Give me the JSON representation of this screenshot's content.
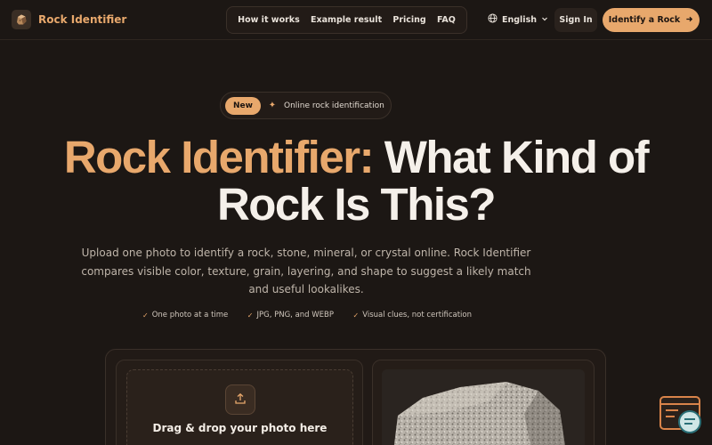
{
  "header": {
    "brand": "Rock Identifier",
    "nav": [
      "How it works",
      "Example result",
      "Pricing",
      "FAQ"
    ],
    "language": "English",
    "sign_in": "Sign In",
    "cta": "Identify a Rock"
  },
  "badge": {
    "label": "New",
    "text": "Online rock identification"
  },
  "hero": {
    "title_accent": "Rock Identifier:",
    "title_rest": "What Kind of Rock Is This?",
    "subtitle": "Upload one photo to identify a rock, stone, mineral, or crystal online. Rock Identifier compares visible color, texture, grain, layering, and shape to suggest a likely match and useful lookalikes."
  },
  "features": [
    "One photo at a time",
    "JPG, PNG, and WEBP",
    "Visual clues, not certification"
  ],
  "upload": {
    "drop_text": "Drag & drop your photo here"
  },
  "colors": {
    "accent": "#e8a86c",
    "background": "#1c1714"
  }
}
